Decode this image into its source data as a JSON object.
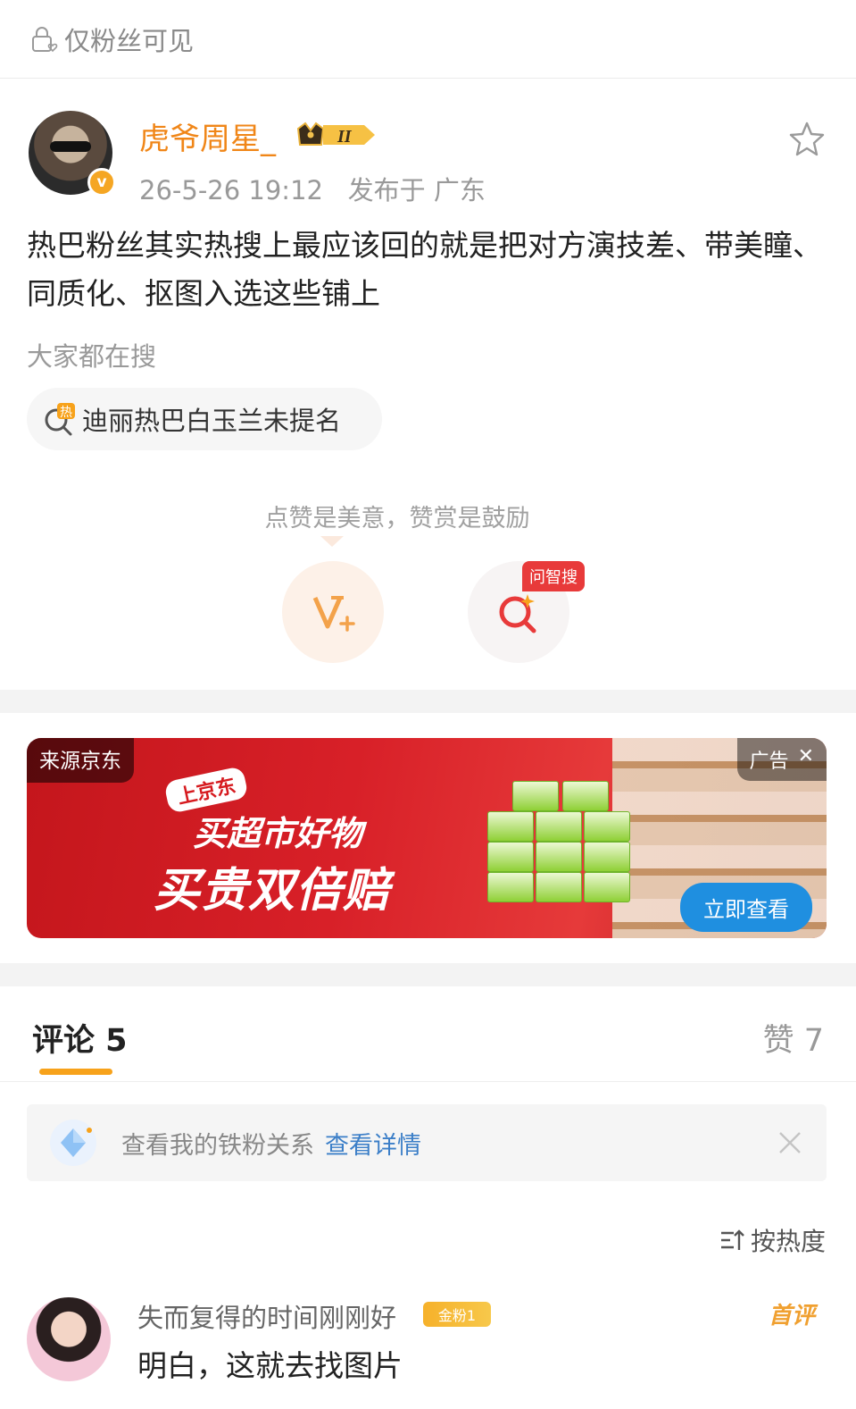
{
  "visibility": {
    "label": "仅粉丝可见"
  },
  "post": {
    "author": "虎爷周星_",
    "level_badge": "II",
    "time": "26-5-26 19:12",
    "location": "发布于 广东",
    "text": "热巴粉丝其实热搜上最应该回的就是把对方演技差、带美瞳、同质化、抠图入选这些铺上",
    "search_label": "大家都在搜",
    "hot_search": "迪丽热巴白玉兰未提名",
    "hot_tag": "热"
  },
  "actions": {
    "like_hint": "点赞是美意，赞赏是鼓励",
    "zhisou_tag": "问智搜"
  },
  "ad": {
    "source": "来源京东",
    "tag": "广告",
    "jd_label": "上京东",
    "line1": "买超市好物",
    "line2": "买贵双倍赔",
    "cta": "立即查看"
  },
  "tabs": {
    "comments": "评论 5",
    "likes": "赞 7"
  },
  "fans": {
    "text": "查看我的铁粉关系",
    "link": "查看详情"
  },
  "sort": {
    "label": "按热度"
  },
  "comment": {
    "author": "失而复得的时间刚刚好",
    "badge": "金粉1",
    "first_tag": "首评",
    "text": "明白，这就去找图片"
  },
  "colors": {
    "accent": "#f08618",
    "tab_underline": "#f7a21b",
    "link": "#3c7fc8",
    "ad_red": "#d82028"
  }
}
